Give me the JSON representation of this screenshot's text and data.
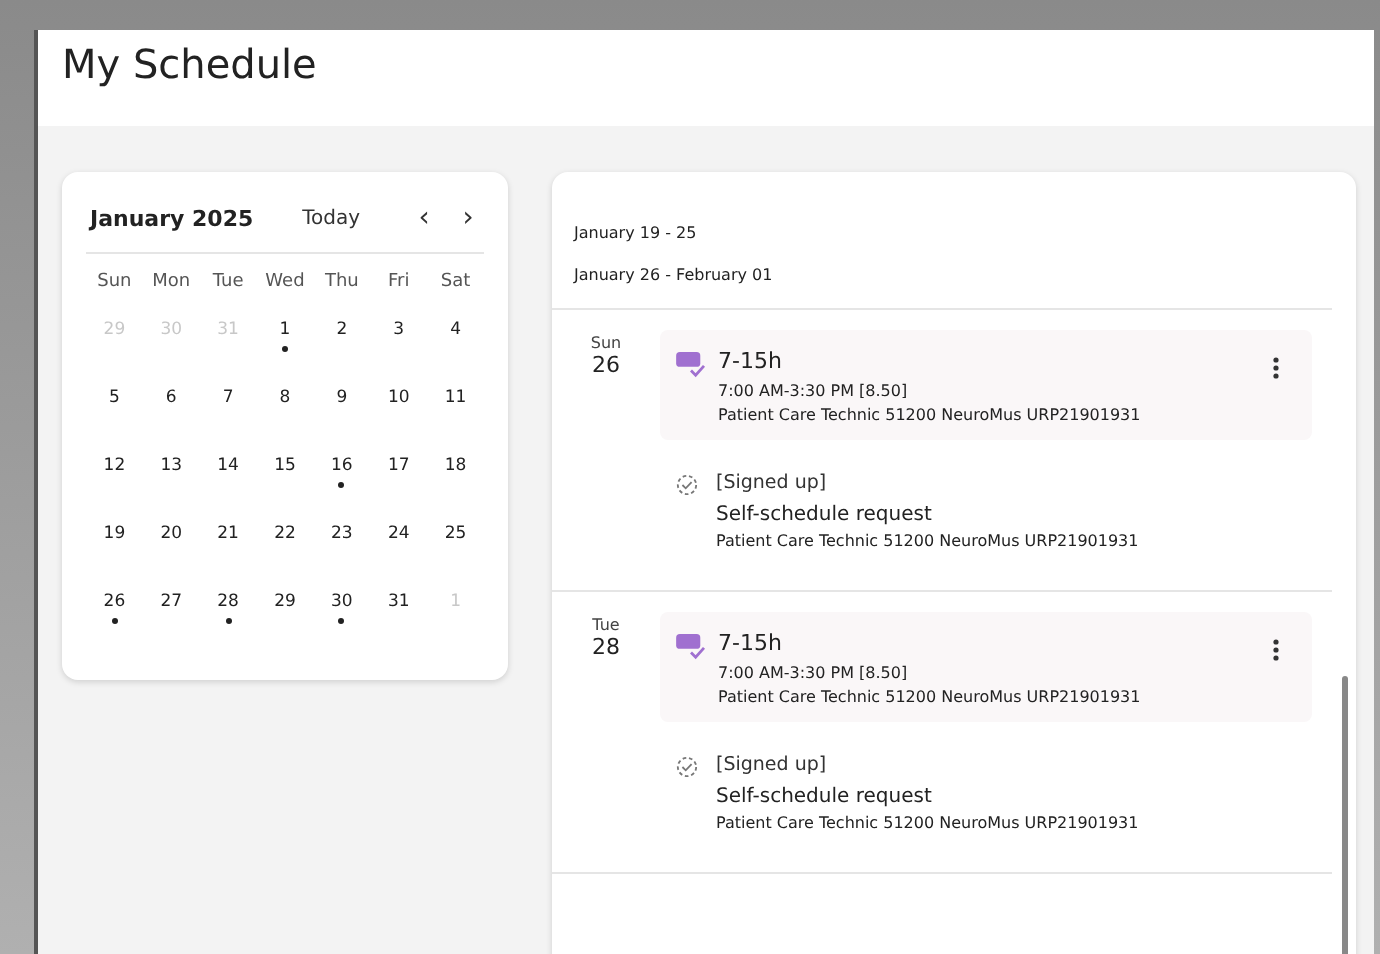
{
  "page": {
    "title": "My Schedule"
  },
  "calendar": {
    "month": "January 2025",
    "today_button": "Today",
    "prev": "‹",
    "next": "›",
    "weekdays": [
      "Sun",
      "Mon",
      "Tue",
      "Wed",
      "Thu",
      "Fri",
      "Sat"
    ],
    "weeks": [
      [
        {
          "day": "29",
          "muted": true,
          "event": false
        },
        {
          "day": "30",
          "muted": true,
          "event": false
        },
        {
          "day": "31",
          "muted": true,
          "event": false
        },
        {
          "day": "1",
          "muted": false,
          "event": true
        },
        {
          "day": "2",
          "muted": false,
          "event": false
        },
        {
          "day": "3",
          "muted": false,
          "event": false
        },
        {
          "day": "4",
          "muted": false,
          "event": false
        }
      ],
      [
        {
          "day": "5",
          "muted": false,
          "event": false
        },
        {
          "day": "6",
          "muted": false,
          "event": false
        },
        {
          "day": "7",
          "muted": false,
          "event": false
        },
        {
          "day": "8",
          "muted": false,
          "event": false
        },
        {
          "day": "9",
          "muted": false,
          "event": false
        },
        {
          "day": "10",
          "muted": false,
          "event": false
        },
        {
          "day": "11",
          "muted": false,
          "event": false
        }
      ],
      [
        {
          "day": "12",
          "muted": false,
          "event": false
        },
        {
          "day": "13",
          "muted": false,
          "event": false
        },
        {
          "day": "14",
          "muted": false,
          "event": false
        },
        {
          "day": "15",
          "muted": false,
          "event": false
        },
        {
          "day": "16",
          "muted": false,
          "event": true
        },
        {
          "day": "17",
          "muted": false,
          "event": false
        },
        {
          "day": "18",
          "muted": false,
          "event": false
        }
      ],
      [
        {
          "day": "19",
          "muted": false,
          "event": false
        },
        {
          "day": "20",
          "muted": false,
          "event": false
        },
        {
          "day": "21",
          "muted": false,
          "event": false
        },
        {
          "day": "22",
          "muted": false,
          "event": false
        },
        {
          "day": "23",
          "muted": false,
          "event": false
        },
        {
          "day": "24",
          "muted": false,
          "event": false
        },
        {
          "day": "25",
          "muted": false,
          "event": false
        }
      ],
      [
        {
          "day": "26",
          "muted": false,
          "event": true
        },
        {
          "day": "27",
          "muted": false,
          "event": false
        },
        {
          "day": "28",
          "muted": false,
          "event": true
        },
        {
          "day": "29",
          "muted": false,
          "event": false
        },
        {
          "day": "30",
          "muted": false,
          "event": true
        },
        {
          "day": "31",
          "muted": false,
          "event": false
        },
        {
          "day": "1",
          "muted": true,
          "event": false
        }
      ]
    ]
  },
  "schedule": {
    "weeks": [
      "January 19 - 25",
      "January 26 - February 01"
    ],
    "days": [
      {
        "weekday": "Sun",
        "date": "26",
        "shift": {
          "title": "7-15h",
          "time": "7:00 AM-3:30 PM [8.50]",
          "position": "Patient Care Technic 51200 NeuroMus URP21901931"
        },
        "request": {
          "status": "[Signed up]",
          "title": "Self-schedule request",
          "position": "Patient Care Technic 51200 NeuroMus URP21901931"
        }
      },
      {
        "weekday": "Tue",
        "date": "28",
        "shift": {
          "title": "7-15h",
          "time": "7:00 AM-3:30 PM [8.50]",
          "position": "Patient Care Technic 51200 NeuroMus URP21901931"
        },
        "request": {
          "status": "[Signed up]",
          "title": "Self-schedule request",
          "position": "Patient Care Technic 51200 NeuroMus URP21901931"
        }
      }
    ]
  }
}
